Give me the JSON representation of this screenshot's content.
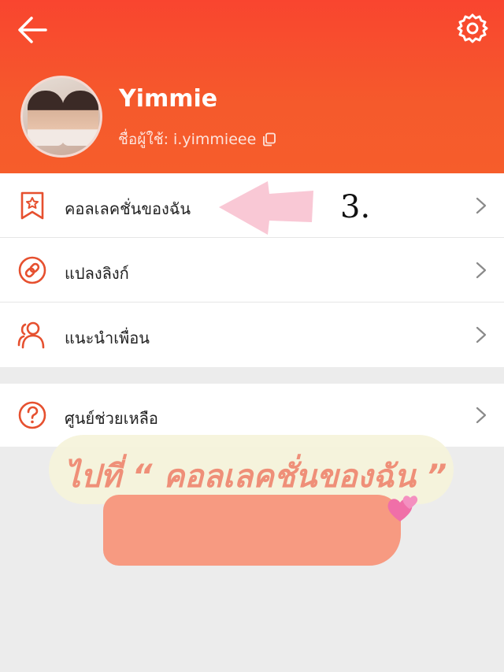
{
  "header": {
    "username": "Yimmie",
    "handle_label": "ชื่อผู้ใช้: i.yimmieee",
    "back_icon": "arrow-left-icon",
    "settings_icon": "gear-icon",
    "accent": "#f9452f"
  },
  "menu": {
    "items": [
      {
        "label": "คอลเลคชั่นของฉัน",
        "icon": "bookmark-star-icon"
      },
      {
        "label": "แปลงลิงก์",
        "icon": "link-icon"
      },
      {
        "label": "แนะนำเพื่อน",
        "icon": "users-icon"
      }
    ],
    "help": {
      "label": "ศูนย์ช่วยเหลือ",
      "icon": "question-circle-icon"
    }
  },
  "annotation": {
    "step_number": "3.",
    "instruction": "ไปที่ “ คอลเลคชั่นของฉัน ”"
  }
}
